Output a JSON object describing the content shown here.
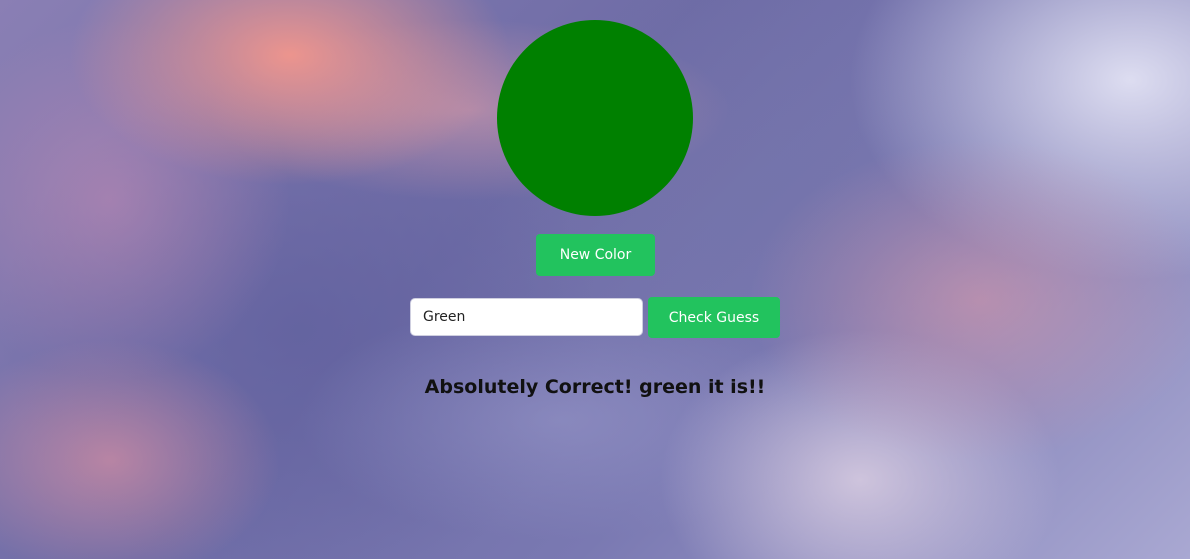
{
  "colors": {
    "displayed_color": "#008000",
    "button_bg": "#22c35e",
    "result_text": "#111111"
  },
  "game": {
    "new_color_label": "New Color",
    "guess_value": "Green",
    "check_label": "Check Guess",
    "result_message": "Absolutely Correct! green it is!!"
  }
}
